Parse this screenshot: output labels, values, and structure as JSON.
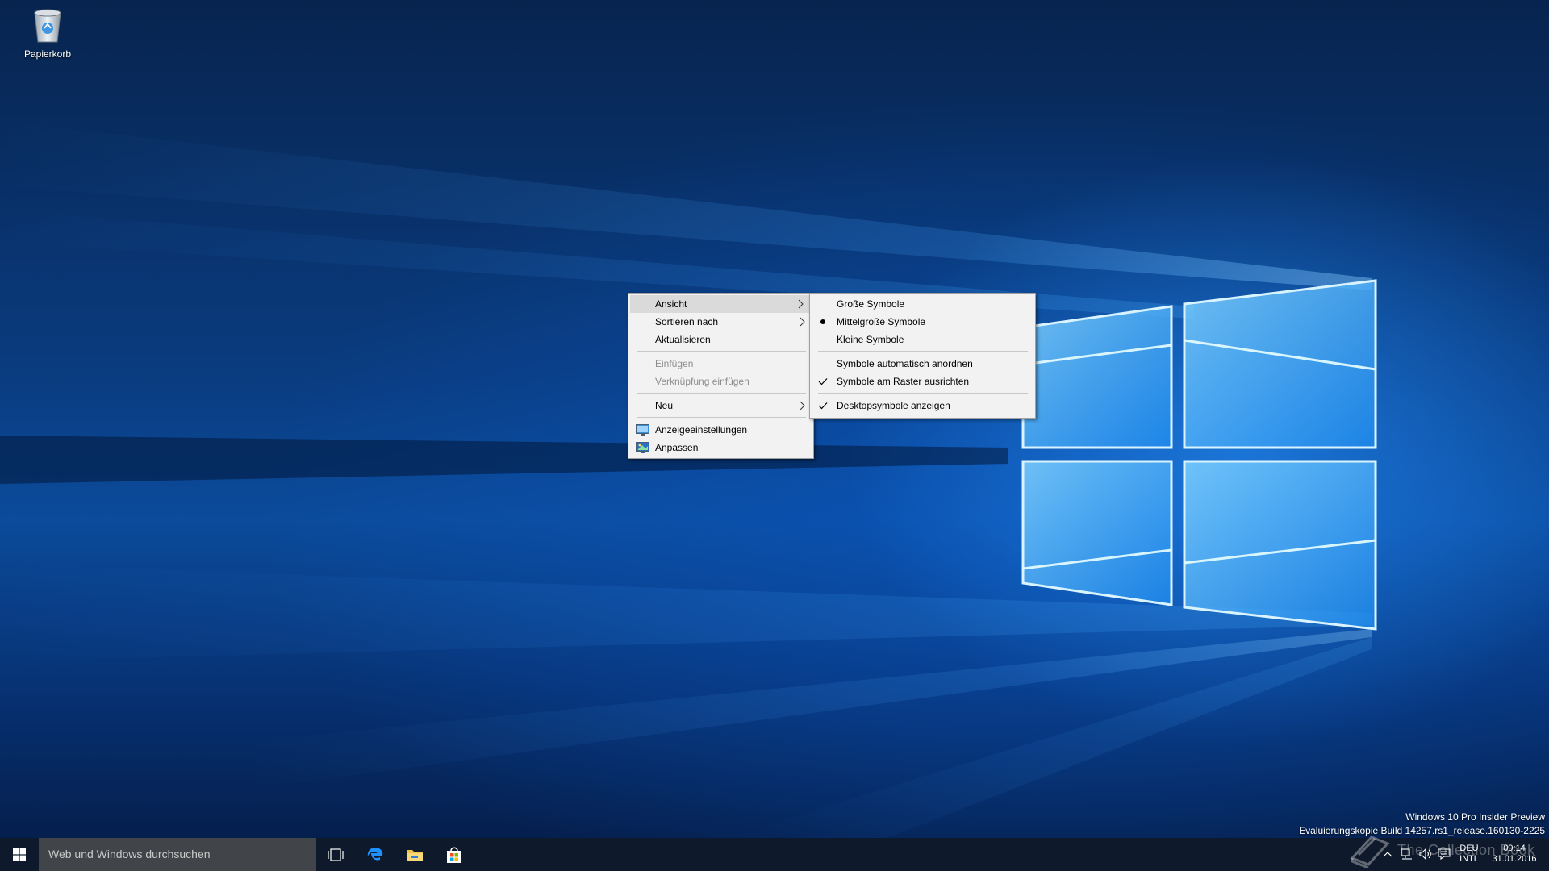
{
  "desktop": {
    "icons": [
      {
        "label": "Papierkorb",
        "icon": "recycle-bin-icon"
      }
    ]
  },
  "context_menu": {
    "items": [
      {
        "label": "Ansicht",
        "state": "active",
        "submenu": true
      },
      {
        "label": "Sortieren nach",
        "state": "normal",
        "submenu": true
      },
      {
        "label": "Aktualisieren",
        "state": "normal"
      },
      {
        "label": "Einfügen",
        "state": "disabled"
      },
      {
        "label": "Verknüpfung einfügen",
        "state": "disabled"
      },
      {
        "label": "Neu",
        "state": "normal",
        "submenu": true
      },
      {
        "label": "Anzeigeeinstellungen",
        "state": "normal",
        "icon": "display-settings-icon"
      },
      {
        "label": "Anpassen",
        "state": "normal",
        "icon": "personalize-icon"
      }
    ]
  },
  "view_submenu": {
    "items": [
      {
        "label": "Große Symbole",
        "mark": ""
      },
      {
        "label": "Mittelgroße Symbole",
        "mark": "radio"
      },
      {
        "label": "Kleine Symbole",
        "mark": ""
      },
      {
        "label": "Symbole automatisch anordnen",
        "mark": ""
      },
      {
        "label": "Symbole am Raster ausrichten",
        "mark": "check"
      },
      {
        "label": "Desktopsymbole anzeigen",
        "mark": "check"
      }
    ]
  },
  "watermark": {
    "line1": "Windows 10 Pro Insider Preview",
    "line2": "Evaluierungskopie Build 14257.rs1_release.160130-2225"
  },
  "brand_watermark": {
    "text": "The Collection Book"
  },
  "taskbar": {
    "search_placeholder": "Web und Windows durchsuchen",
    "pinned": [
      "task-view-icon",
      "edge-icon",
      "file-explorer-icon",
      "store-icon"
    ],
    "tray": {
      "language_line1": "DEU",
      "language_line2": "INTL",
      "time": "09:14",
      "date": "31.01.2016"
    }
  },
  "colors": {
    "taskbar_bg": "#0e1a2b",
    "search_bg": "#414549",
    "menu_bg": "#f2f2f2",
    "menu_active": "#dadada",
    "disabled_text": "#8d8d8d"
  }
}
